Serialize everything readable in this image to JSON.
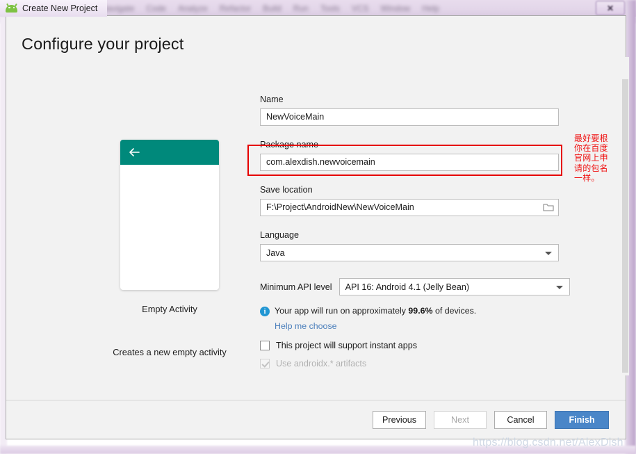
{
  "window": {
    "title": "Create New Project",
    "app_icon": "android-robot-icon",
    "close_label": "✕",
    "background_menu_items": [
      "Navigate",
      "Code",
      "Analyze",
      "Refactor",
      "Build",
      "Run",
      "Tools",
      "VCS",
      "Window",
      "Help"
    ]
  },
  "dialog": {
    "page_title": "Configure your project"
  },
  "preview": {
    "template_name": "Empty Activity",
    "description": "Creates a new empty activity",
    "appbar_color": "#00897b",
    "back_icon": "arrow-left-icon"
  },
  "form": {
    "name": {
      "label": "Name",
      "value": "NewVoiceMain",
      "placeholder": "Name"
    },
    "package_name": {
      "label": "Package name",
      "value": "com.alexdish.newvoicemain",
      "placeholder": "Package name",
      "highlight_color": "#e60000"
    },
    "save_location": {
      "label": "Save location",
      "value": "F:\\Project\\AndroidNew\\NewVoiceMain",
      "placeholder": "Save location",
      "browse_icon": "folder-icon"
    },
    "language": {
      "label": "Language",
      "value": "Java",
      "caret_icon": "chevron-down-icon"
    },
    "minimum_api": {
      "label": "Minimum API level",
      "value": "API 16: Android 4.1 (Jelly Bean)",
      "caret_icon": "chevron-down-icon"
    },
    "device_info": {
      "icon": "info-icon",
      "text_before": "Your app will run on approximately",
      "percent": "99.6%",
      "text_after": "of devices.",
      "help_link": "Help me choose"
    },
    "checkboxes": [
      {
        "label": "This project will support instant apps",
        "checked": false
      },
      {
        "label": "Use androidx.* artifacts",
        "checked": true
      }
    ]
  },
  "annotation": {
    "text": "最好要根你在百度官网上申请的包名一样。",
    "color": "#f01010"
  },
  "buttons": {
    "previous": "Previous",
    "next": "Next",
    "cancel": "Cancel",
    "finish": "Finish",
    "next_disabled": true,
    "finish_color": "#4a86c8"
  },
  "watermark": {
    "text": "https://blog.csdn.net/AlexDish"
  }
}
